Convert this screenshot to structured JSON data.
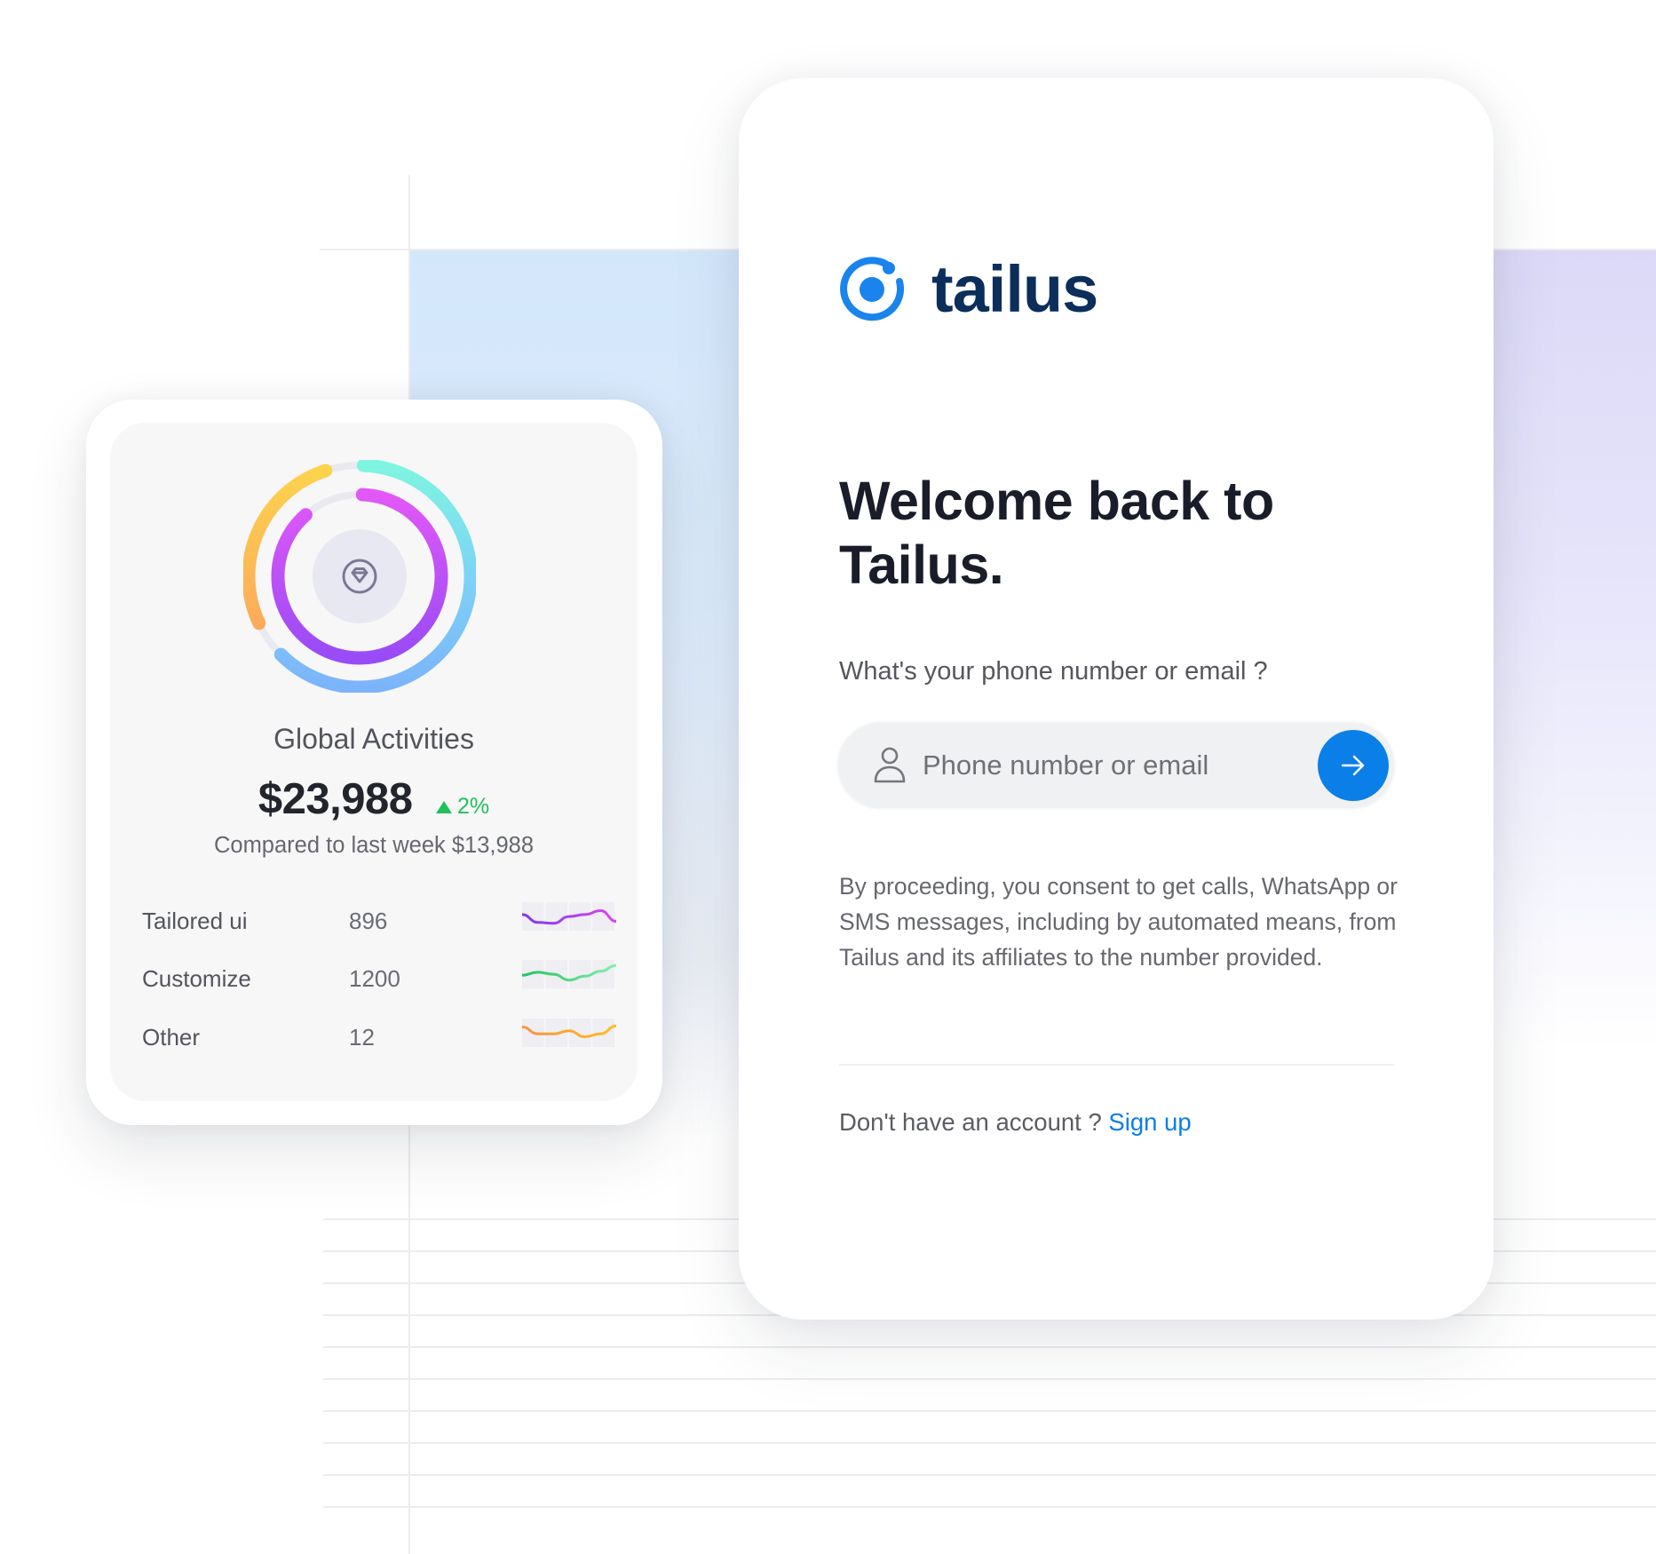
{
  "login": {
    "brand_name": "tailus",
    "heading_line1": "Welcome back to",
    "heading_line2": "Tailus.",
    "question": "What's your phone number or email ?",
    "input": {
      "value": "",
      "placeholder": "Phone number or email",
      "icon": "user-icon"
    },
    "submit_icon": "arrow-right-icon",
    "consent_text": "By proceeding, you consent to get calls, WhatsApp or SMS messages, including by automated means, from Tailus and its affiliates to the number provided.",
    "signup_prompt": "Don't have an account ?",
    "signup_link": "Sign up",
    "colors": {
      "brand_blue": "#0a7fe8",
      "brand_navy": "#0b2e5b"
    }
  },
  "stats": {
    "center_icon": "diamond-icon",
    "title": "Global Activities",
    "amount": "$23,988",
    "change": "2%",
    "change_direction": "up",
    "compare_text": "Compared to last week $13,988",
    "rows": [
      {
        "label": "Tailored ui",
        "value": "896",
        "color_start": "#7c3aed",
        "color_end": "#d946ef",
        "trend": [
          0.55,
          0.15,
          0.1,
          0.45,
          0.55,
          0.75,
          0.2
        ]
      },
      {
        "label": "Customize",
        "value": "1200",
        "color_start": "#22c55e",
        "color_end": "#86efac",
        "trend": [
          0.4,
          0.55,
          0.45,
          0.15,
          0.35,
          0.6,
          0.9
        ]
      },
      {
        "label": "Other",
        "value": "12",
        "color_start": "#fb923c",
        "color_end": "#fbbf24",
        "trend": [
          0.75,
          0.4,
          0.4,
          0.55,
          0.25,
          0.4,
          0.8
        ]
      }
    ],
    "rings": {
      "outer_segments": [
        {
          "from": "#fcd34d",
          "to": "#fdb05e",
          "fraction": 0.27
        },
        {
          "from": "#7ef5e0",
          "to": "#7cb8fb",
          "fraction": 0.62
        }
      ],
      "inner_segments": [
        {
          "from": "#e055f5",
          "to": "#9b4df7",
          "fraction": 0.88
        }
      ]
    }
  }
}
